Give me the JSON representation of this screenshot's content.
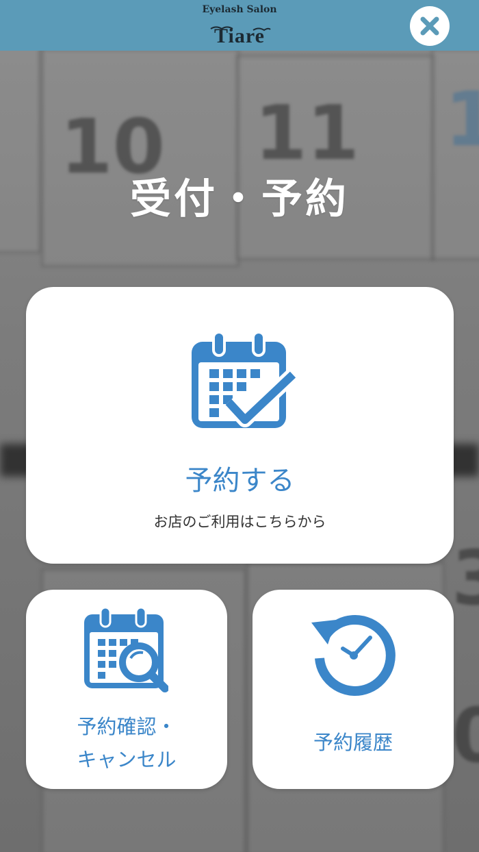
{
  "header": {
    "logo_top": "Eyelash Salon",
    "logo_main": "Tiare",
    "close_label": "✕"
  },
  "page": {
    "title": "受付・予約"
  },
  "main_card": {
    "label": "予約する",
    "sub": "お店のご利用はこちらから",
    "icon": "calendar-check-icon"
  },
  "confirm_card": {
    "label_line1": "予約確認・",
    "label_line2": "キャンセル",
    "icon": "calendar-search-icon"
  },
  "history_card": {
    "label": "予約履歴",
    "icon": "history-clock-icon"
  },
  "colors": {
    "header": "#5b9bb8",
    "accent": "#3b86c9",
    "card": "#ffffff"
  }
}
